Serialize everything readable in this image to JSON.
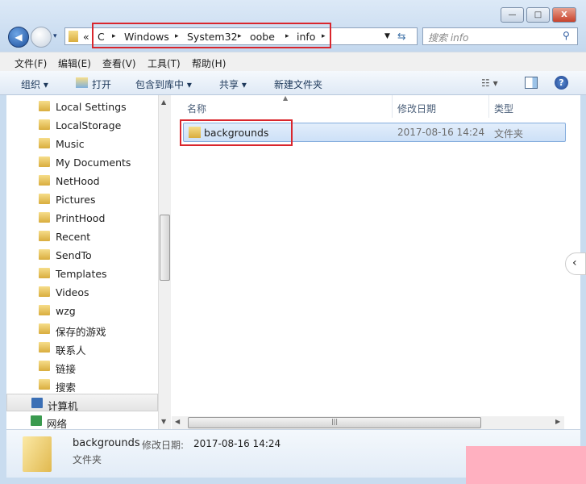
{
  "window": {
    "minimize": "—",
    "maximize": "□",
    "close": "X"
  },
  "address": {
    "overflow": "«",
    "crumbs": [
      "C",
      "Windows",
      "System32",
      "oobe",
      "info"
    ],
    "sep": "▸"
  },
  "search": {
    "placeholder": "搜索 info"
  },
  "menu": [
    "文件(F)",
    "编辑(E)",
    "查看(V)",
    "工具(T)",
    "帮助(H)"
  ],
  "toolbar": {
    "organize": "组织 ▾",
    "open": "打开",
    "include": "包含到库中 ▾",
    "share": "共享 ▾",
    "new_folder": "新建文件夹"
  },
  "sidebar": {
    "items": [
      "Local Settings",
      "LocalStorage",
      "Music",
      "My Documents",
      "NetHood",
      "Pictures",
      "PrintHood",
      "Recent",
      "SendTo",
      "Templates",
      "Videos",
      "wzg",
      "保存的游戏",
      "联系人",
      "链接",
      "搜索"
    ],
    "computer": "计算机",
    "network": "网络"
  },
  "columns": {
    "name": "名称",
    "modified": "修改日期",
    "type": "类型"
  },
  "files": [
    {
      "name": "backgrounds",
      "modified": "2017-08-16 14:24",
      "type": "文件夹"
    }
  ],
  "status": {
    "name": "backgrounds",
    "modified_label": "修改日期:",
    "modified": "2017-08-16 14:24",
    "type": "文件夹"
  },
  "colors": {
    "highlight": "#d9262d",
    "watermark": "#ffb0c0"
  }
}
